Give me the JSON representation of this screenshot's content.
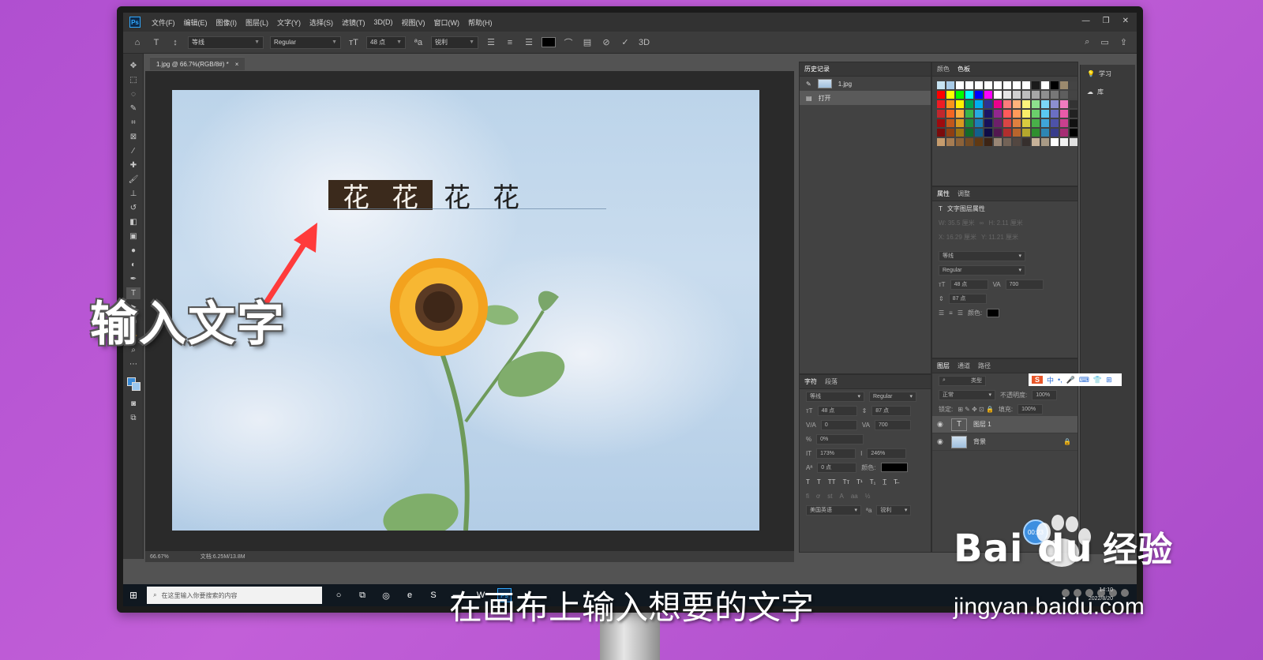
{
  "menu": {
    "logo": "Ps",
    "items": [
      "文件(F)",
      "编辑(E)",
      "图像(I)",
      "图层(L)",
      "文字(Y)",
      "选择(S)",
      "滤镜(T)",
      "3D(D)",
      "视图(V)",
      "窗口(W)",
      "帮助(H)"
    ]
  },
  "options": {
    "font_family": "等线",
    "font_style": "Regular",
    "font_size": "48 点",
    "aa_method": "锐利",
    "color": "#000000"
  },
  "document": {
    "tab_label": "1.jpg @ 66.7%(RGB/8#) *",
    "zoom": "66.67%",
    "doc_info": "文档:6.25M/13.8M",
    "typed_chars": [
      "花",
      "花",
      "花",
      "花"
    ],
    "selected_count": 2
  },
  "history": {
    "tab": "历史记录",
    "snapshot": "1.jpg",
    "steps": [
      "打开"
    ]
  },
  "swatch_panel": {
    "tabs": [
      "颜色",
      "色板"
    ],
    "rows": [
      [
        "#c7e3f2",
        "#a8cbe8",
        "#ffffff",
        "#ffffff",
        "#ffffff",
        "#ffffff",
        "#ffffff",
        "#ffffff",
        "#ffffff",
        "#ffffff",
        "#1a1a1a",
        "#ffffff",
        "#000000",
        "#9c8a6e",
        "#444444"
      ],
      [
        "#ff0000",
        "#ffff00",
        "#00ff00",
        "#00ffff",
        "#0000ff",
        "#ff00ff",
        "#ffffff",
        "#e6e6e6",
        "#d0d0d0",
        "#bdbdbd",
        "#a6a6a6",
        "#8f8f8f",
        "#777777",
        "#5e5e5e",
        "#444444"
      ],
      [
        "#ed1c24",
        "#f7941d",
        "#fff200",
        "#00a651",
        "#00aeef",
        "#2e3192",
        "#ec008c",
        "#ff7b7b",
        "#ffb37b",
        "#fff57b",
        "#8de08d",
        "#7bd7f7",
        "#8c8fd0",
        "#f07bc0",
        "#333333"
      ],
      [
        "#c1272d",
        "#f26522",
        "#fbaf3f",
        "#39b54a",
        "#27aae1",
        "#1b1464",
        "#92278f",
        "#ff5a5a",
        "#ff9a5a",
        "#f9ed69",
        "#6bcf6b",
        "#5ac8f2",
        "#6b6fc2",
        "#e95aa8",
        "#222222"
      ],
      [
        "#9e0b0f",
        "#c1571b",
        "#d99a1f",
        "#1e8c3a",
        "#1b7fb5",
        "#16115a",
        "#6d1f6b",
        "#d94545",
        "#e0803f",
        "#d9cc3f",
        "#49b049",
        "#3fa5d9",
        "#4d52a8",
        "#c9408e",
        "#111111"
      ],
      [
        "#7a0c0c",
        "#8f3f12",
        "#9c7412",
        "#126b2a",
        "#12608c",
        "#0f0c45",
        "#521750",
        "#b02e2e",
        "#b8652d",
        "#b3a72d",
        "#2f8f2f",
        "#2d86b3",
        "#383c8c",
        "#a62d74",
        "#000000"
      ],
      [
        "#c69c6d",
        "#a67c52",
        "#8c6239",
        "#754c24",
        "#603913",
        "#3c2415",
        "#998675",
        "#736357",
        "#534741",
        "#362f2d",
        "#c7b299",
        "#a89a85",
        "#ffffff",
        "#f2f2f2",
        "#e0e0e0"
      ]
    ]
  },
  "properties": {
    "tabs": [
      "属性",
      "调整"
    ],
    "header": "文字图层属性",
    "w": "W: 35.5 厘米",
    "h": "H: 2.11 厘米",
    "x": "X: 16.29 厘米",
    "y": "Y: 11.21 厘米",
    "font": "等线",
    "style": "Regular",
    "size": "48 点",
    "tracking": "700",
    "leading": "87 点",
    "color_label": "颜色:"
  },
  "layers": {
    "tabs": [
      "图层",
      "通道",
      "路径"
    ],
    "search": "类型",
    "blend": "正常",
    "opacity_label": "不透明度:",
    "opacity": "100%",
    "lock_label": "锁定:",
    "fill_label": "填充:",
    "fill": "100%",
    "items": [
      {
        "name": "图层 1",
        "kind": "T"
      },
      {
        "name": "背景",
        "kind": "img"
      }
    ]
  },
  "character": {
    "tabs": [
      "字符",
      "段落"
    ],
    "font": "等线",
    "style": "Regular",
    "size": "48 点",
    "leading": "87 点",
    "kerning": "0",
    "tracking": "700",
    "scale_pct": "0%",
    "v_scale": "173%",
    "h_scale": "246%",
    "baseline": "0 点",
    "color_label": "颜色:",
    "language": "美国英语",
    "aa": "锐利"
  },
  "far_panel": {
    "items": [
      "学习",
      "库"
    ]
  },
  "timer": "00:23",
  "taskbar": {
    "search_placeholder": "在这里输入你要搜索的内容",
    "clock_time": "14:10",
    "clock_date": "2022/8/20"
  },
  "overlay": {
    "label": "输入文字",
    "subtitle": "在画布上输入想要的文字",
    "arrow_color": "#ff3b3b"
  },
  "watermark": {
    "logo": "Bai du",
    "brand_text": "经验",
    "url": "jingyan.baidu.com"
  },
  "ime": {
    "brand": "S",
    "mode": "中"
  }
}
